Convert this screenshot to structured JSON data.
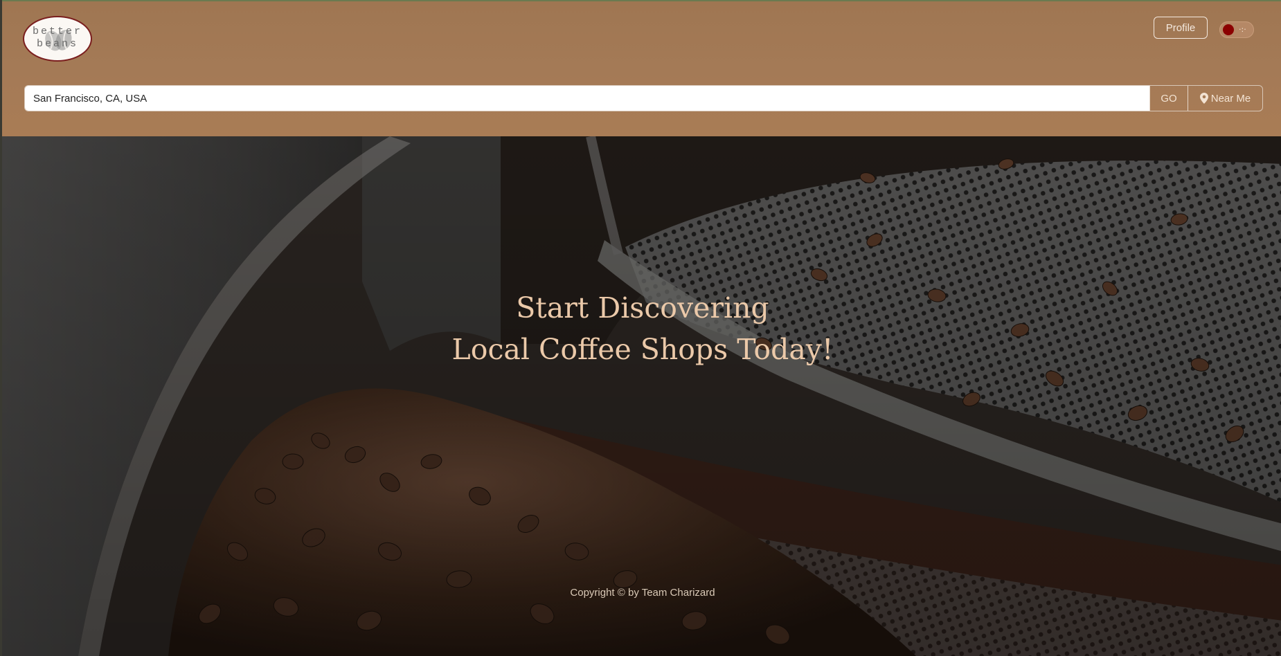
{
  "header": {
    "logo": {
      "alt_text_line1": "better",
      "alt_text_line2": "beans",
      "icon": "coffee-bean-logo"
    },
    "profile_label": "Profile",
    "theme_toggle": {
      "icon": "theme-toggle",
      "state": "off"
    }
  },
  "search": {
    "value": "San Francisco, CA, USA",
    "go_label": "GO",
    "near_me_label": "Near Me",
    "near_me_icon": "map-pin-icon"
  },
  "hero": {
    "title_line1": "Start Discovering",
    "title_line2": "Local Coffee Shops Today!",
    "background": "coffee-beans-roaster-photo"
  },
  "footer": {
    "copyright": "Copyright © by Team Charizard"
  },
  "colors": {
    "header_bg": "#a47a56",
    "hero_text": "#ebc9a9",
    "toggle_knob": "#8b0000",
    "logo_border": "#7a1e1e"
  }
}
